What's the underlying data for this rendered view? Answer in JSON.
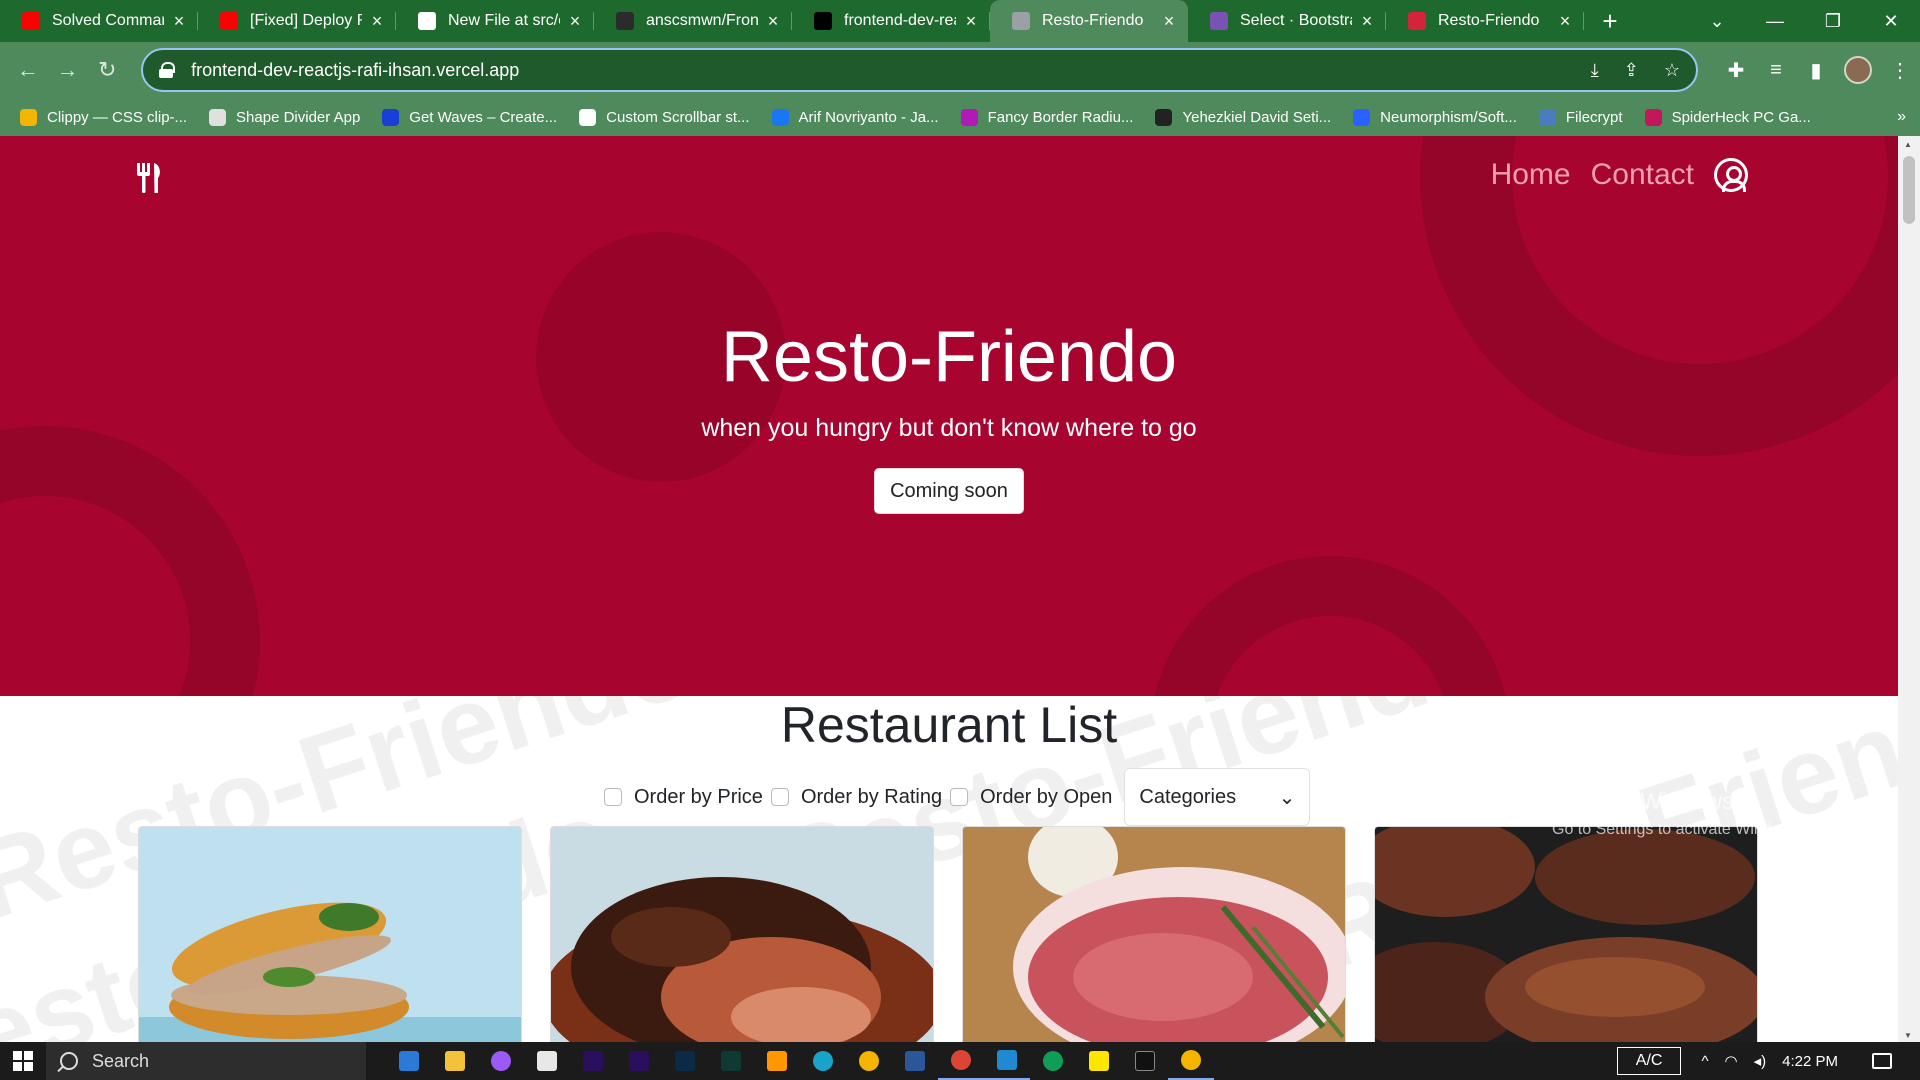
{
  "browser": {
    "tabs": [
      {
        "title": "Solved Command",
        "favicon": "youtube-icon",
        "color": "#ff0000"
      },
      {
        "title": "[Fixed] Deploy Re",
        "favicon": "youtube-icon",
        "color": "#ff0000"
      },
      {
        "title": "New File at src/co",
        "favicon": "github-icon",
        "color": "#ffffff"
      },
      {
        "title": "anscsmwn/Fronte",
        "favicon": "github-icon",
        "color": "#2b2b2b"
      },
      {
        "title": "frontend-dev-rea",
        "favicon": "vercel-icon",
        "color": "#000000"
      },
      {
        "title": "Resto-Friendo",
        "favicon": "globe-icon",
        "color": "#9aa0a6",
        "active": true
      },
      {
        "title": "Select · Bootstrap",
        "favicon": "bootstrap-icon",
        "color": "#7952b3"
      },
      {
        "title": "Resto-Friendo",
        "favicon": "utensils-icon",
        "color": "#d6233c"
      }
    ],
    "url": "frontend-dev-reactjs-rafi-ihsan.vercel.app",
    "bookmarks": [
      {
        "label": "Clippy — CSS clip-...",
        "color": "#f4b400"
      },
      {
        "label": "Shape Divider App",
        "color": "#e0e0e0"
      },
      {
        "label": "Get Waves – Create...",
        "color": "#1a3fd6"
      },
      {
        "label": "Custom Scrollbar st...",
        "color": "#ffffff"
      },
      {
        "label": "Arif Novriyanto - Ja...",
        "color": "#1877f2"
      },
      {
        "label": "Fancy Border Radiu...",
        "color": "#b01ab5"
      },
      {
        "label": "Yehezkiel David Seti...",
        "color": "#222222"
      },
      {
        "label": "Neumorphism/Soft...",
        "color": "#2962ff"
      },
      {
        "label": "Filecrypt",
        "color": "#4a7dbf"
      },
      {
        "label": "SpiderHeck PC Ga...",
        "color": "#c2185b"
      }
    ],
    "more_bookmarks": "»"
  },
  "page": {
    "nav": {
      "home": "Home",
      "contact": "Contact"
    },
    "hero": {
      "title": "Resto-Friendo",
      "subtitle": "when you hungry but don't know where to go",
      "cta": "Coming soon",
      "bg_color": "#a80430"
    },
    "list": {
      "title": "Restaurant List",
      "filters": [
        "Order by Price",
        "Order by Rating",
        "Order by Open"
      ],
      "categories_label": "Categories",
      "watermark": "Resto-Friendo"
    },
    "cards": [
      {
        "image": "sandwich-photo"
      },
      {
        "image": "pulled-pork-photo"
      },
      {
        "image": "raw-steak-photo"
      },
      {
        "image": "grilled-steaks-photo"
      }
    ]
  },
  "os": {
    "activate_title": "Activate Windows",
    "activate_sub": "Go to Settings to activate Windows.",
    "search_label": "Search",
    "ac_label": "A/C",
    "time": "4:22 PM"
  }
}
